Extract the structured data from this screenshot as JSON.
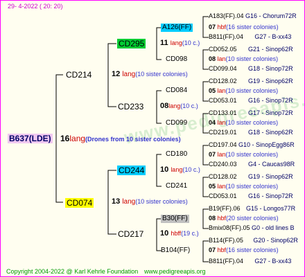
{
  "header": {
    "date": "29-  4-2022 ( 20: 20)"
  },
  "footer": {
    "copyright": "Copyright 2004-2022 @ Karl Kehrle Foundation",
    "site": "www.pedigreeapis.org"
  },
  "watermark": "www.pedigreeapis.org",
  "colors": {
    "border": "#ff00ff",
    "green": "#00cc33",
    "cyan": "#00ccff",
    "yellow": "#ffff00",
    "gray": "#c0c0c0",
    "pink": "#f0c8f0"
  },
  "root": {
    "name": "B637(LDE)",
    "num": "16",
    "lang": "lang",
    "note": "(Drones from 10 sister colonies)"
  },
  "gen1": [
    {
      "name": "CD214",
      "num": "12",
      "lang": "lang",
      "note": "(10 sister colonies)"
    },
    {
      "name": "CD074",
      "num": "13",
      "lang": "lang",
      "note": "(10 sister colonies)"
    }
  ],
  "gen2": [
    {
      "name": "CD295",
      "num": "11",
      "lang": "lang",
      "note": "(10 c.)"
    },
    {
      "name": "CD233",
      "num": "08",
      "lang": "lang",
      "note": "(10 c.)"
    },
    {
      "name": "CD244",
      "num": "10",
      "lang": "lang",
      "note": "(10 c.)"
    },
    {
      "name": "CD217",
      "num": "10",
      "lang": "hbff",
      "note": "(19 c.)"
    }
  ],
  "gen3": [
    {
      "name": "A126(FF)",
      "num": "07",
      "lang": "hbf",
      "note": "(16 sister colonies)"
    },
    {
      "name": "CD098",
      "num": "08",
      "lang": "lan",
      "note": "(10 sister colonies)"
    },
    {
      "name": "CD084",
      "num": "05",
      "lang": "lan",
      "note": "(10 sister colonies)"
    },
    {
      "name": "CD099",
      "num": "04",
      "lang": "lan",
      "note": "(10 sister colonies)"
    },
    {
      "name": "CD180",
      "num": "07",
      "lang": "lan",
      "note": "(10 sister colonies)"
    },
    {
      "name": "CD241",
      "num": "05",
      "lang": "lan",
      "note": "(10 sister colonies)"
    },
    {
      "name": "B30(FF)",
      "num": "08",
      "lang": "hbf",
      "note": "(20 sister colonies)"
    },
    {
      "name": "B104(FF)",
      "num": "07",
      "lang": "hbf",
      "note": "(16 sister colonies)"
    }
  ],
  "gen4": [
    {
      "name": "A183(FF).04",
      "info": "G16 - Chorum72R"
    },
    {
      "name": "B811(FF).04",
      "info": "G27 - B-xx43"
    },
    {
      "name": "CD052.05",
      "info": "G21 - Sinop62R"
    },
    {
      "name": "CD099.04",
      "info": "G18 - Sinop72R"
    },
    {
      "name": "CD128.02",
      "info": "G19 - Sinop62R"
    },
    {
      "name": "CD053.01",
      "info": "G16 - Sinop72R"
    },
    {
      "name": "CD133.01",
      "info": "G17 - Sinop72R"
    },
    {
      "name": "CD219.01",
      "info": "G18 - Sinop62R"
    },
    {
      "name": "CD197.04",
      "info": "G10 - SinopEgg86R"
    },
    {
      "name": "CD240.03",
      "info": "G4 - Caucas98R"
    },
    {
      "name": "CD128.02",
      "info": "G19 - Sinop62R"
    },
    {
      "name": "CD053.01",
      "info": "G16 - Sinop72R"
    },
    {
      "name": "B19(FF).06",
      "info": "G15 - Longos77R"
    },
    {
      "name": "Bmix08(FF).05",
      "info": "G0 - old lines B"
    },
    {
      "name": "B114(FF).05",
      "info": "G20 - Sinop62R"
    },
    {
      "name": "B811(FF).04",
      "info": "G27 - B-xx43"
    }
  ]
}
